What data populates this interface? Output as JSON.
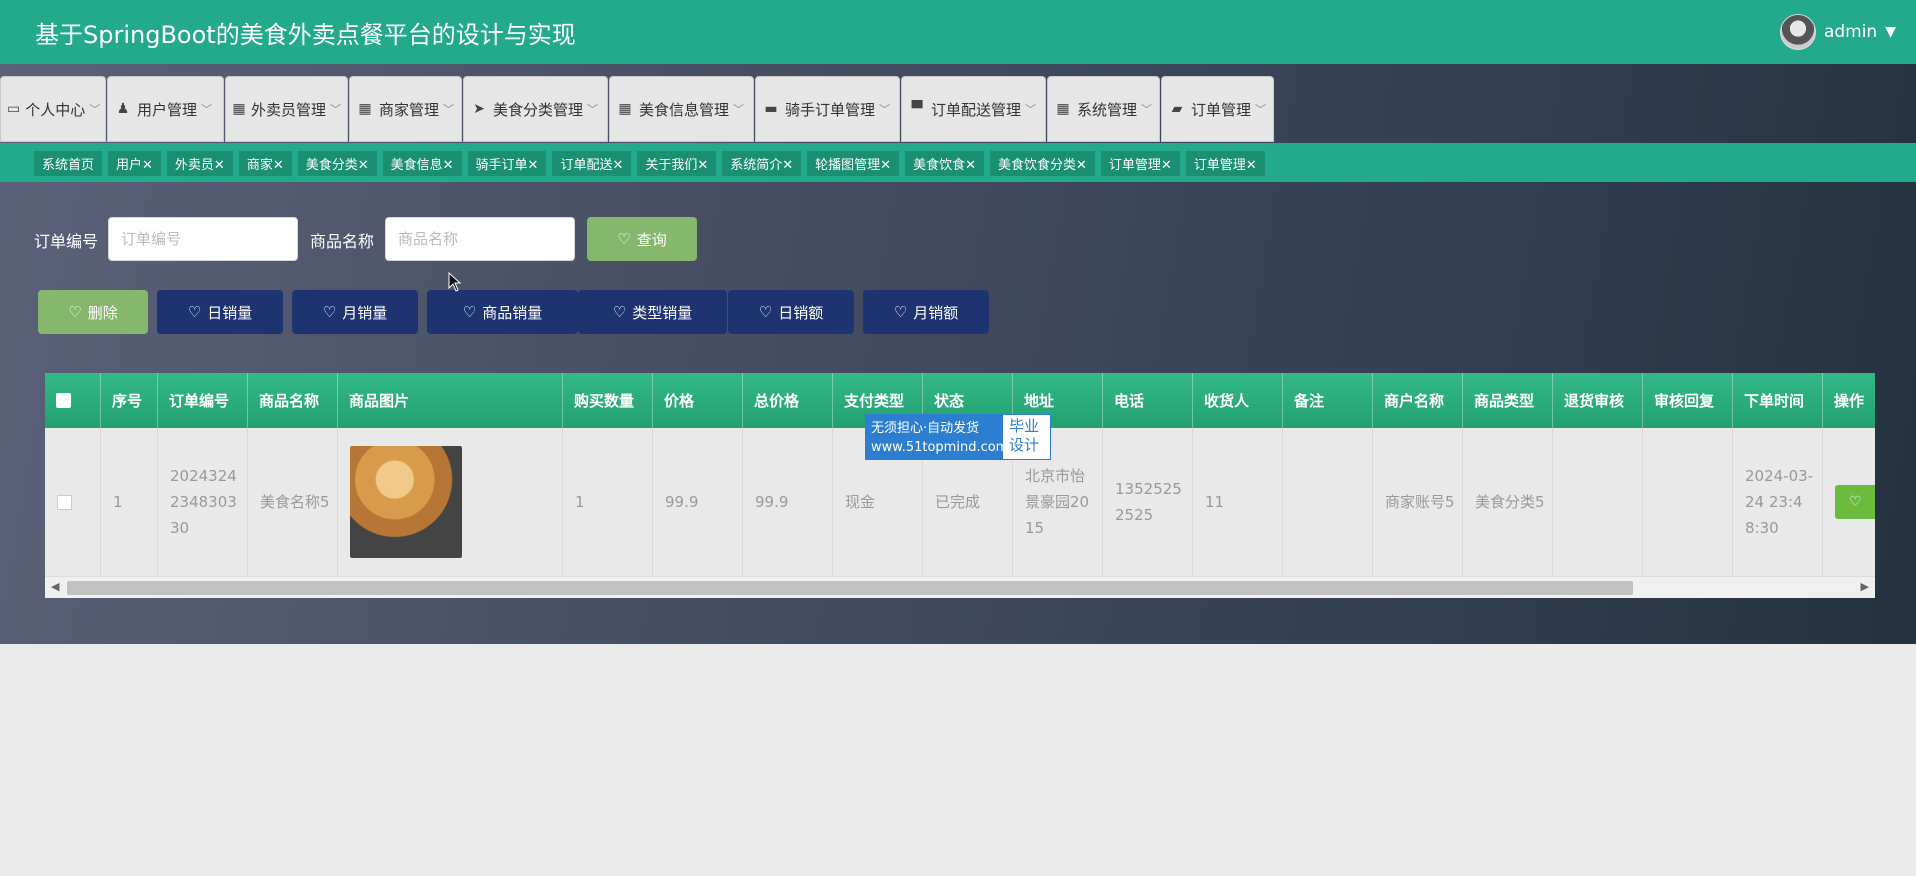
{
  "header": {
    "title": "基于SpringBoot的美食外卖点餐平台的设计与实现",
    "username": "admin"
  },
  "nav": [
    {
      "label": "个人中心",
      "icon": "id-card-icon"
    },
    {
      "label": "用户管理",
      "icon": "user-icon"
    },
    {
      "label": "外卖员管理",
      "icon": "grid-icon"
    },
    {
      "label": "商家管理",
      "icon": "grid-icon"
    },
    {
      "label": "美食分类管理",
      "icon": "paper-plane-icon"
    },
    {
      "label": "美食信息管理",
      "icon": "grid-icon"
    },
    {
      "label": "骑手订单管理",
      "icon": "monitor-icon"
    },
    {
      "label": "订单配送管理",
      "icon": "desktop-icon"
    },
    {
      "label": "系统管理",
      "icon": "grid-icon"
    },
    {
      "label": "订单管理",
      "icon": "ticket-icon"
    }
  ],
  "tags": [
    "系统首页",
    "用户✕",
    "外卖员✕",
    "商家✕",
    "美食分类✕",
    "美食信息✕",
    "骑手订单✕",
    "订单配送✕",
    "关于我们✕",
    "系统简介✕",
    "轮播图管理✕",
    "美食饮食✕",
    "美食饮食分类✕",
    "订单管理✕",
    "订单管理✕"
  ],
  "search": {
    "order_no_label": "订单编号",
    "order_no_placeholder": "订单编号",
    "product_label": "商品名称",
    "product_placeholder": "商品名称",
    "query_button": "查询"
  },
  "actions": [
    "删除",
    "日销量",
    "月销量",
    "商品销量",
    "类型销量",
    "日销额",
    "月销额"
  ],
  "table": {
    "columns": [
      "",
      "序号",
      "订单编号",
      "商品名称",
      "商品图片",
      "购买数量",
      "价格",
      "总价格",
      "支付类型",
      "状态",
      "地址",
      "电话",
      "收货人",
      "备注",
      "商户名称",
      "商品类型",
      "退货审核",
      "审核回复",
      "下单时间",
      "操作"
    ],
    "rows": [
      {
        "index": "1",
        "order_no": "20243242348303 30",
        "product_name": "美食名称5",
        "quantity": "1",
        "price": "99.9",
        "total": "99.9",
        "pay_type": "现金",
        "status": "已完成",
        "address": "北京市怡景豪园2015",
        "phone": "13525252525",
        "receiver": "11",
        "remark": "",
        "merchant": "商家账号5",
        "category": "美食分类5",
        "return_review": "",
        "review_reply": "",
        "order_time": "2024-03-24 23:48:30"
      }
    ]
  },
  "watermark": {
    "line1": "无须担心·自动发货",
    "line2": "www.51topmind.com",
    "side1": "毕业",
    "side2": "设计"
  },
  "colors": {
    "header": "#23a98b",
    "nav_bg": "#e6e6e6",
    "navy_button": "#1e3470",
    "green_button": "#85b86c",
    "table_header": "#23a06f"
  }
}
